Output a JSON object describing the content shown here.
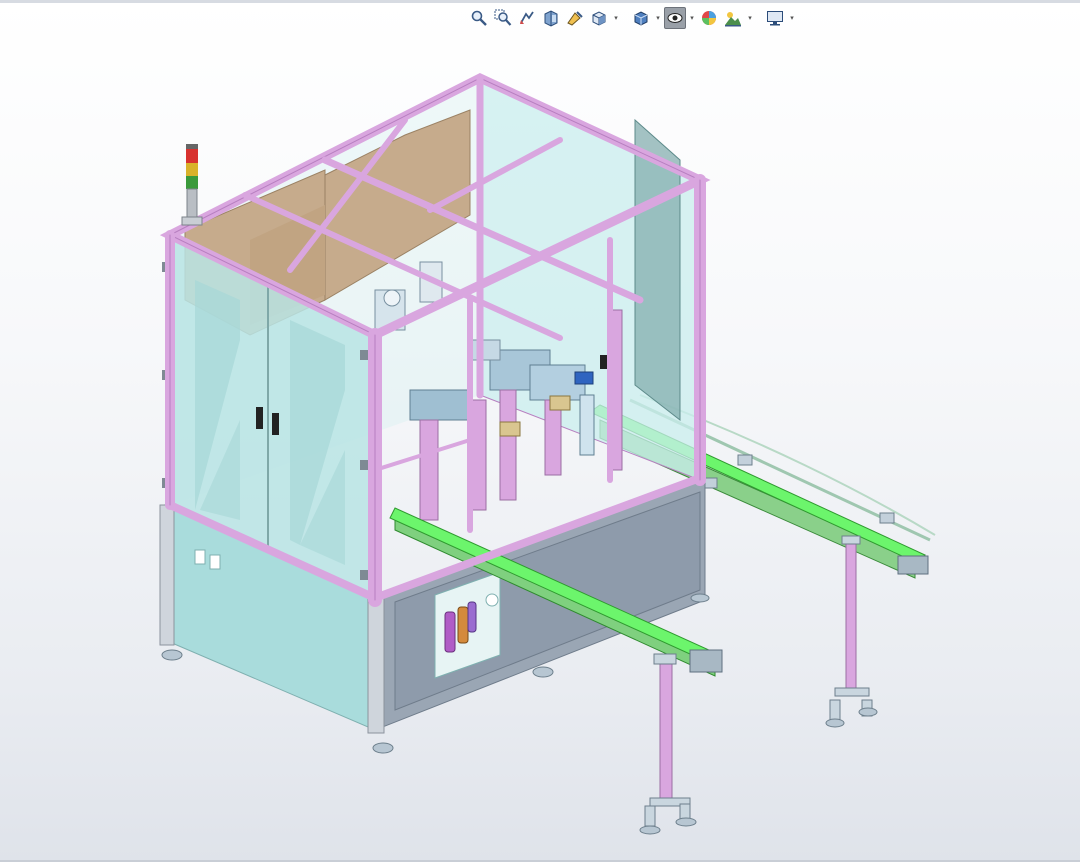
{
  "toolbar": {
    "buttons": [
      {
        "icon": "zoom-to-fit-icon"
      },
      {
        "icon": "zoom-to-area-icon"
      },
      {
        "icon": "previous-view-icon"
      },
      {
        "icon": "section-view-icon"
      },
      {
        "icon": "dynamic-annotation-icon"
      },
      {
        "icon": "view-orientation-icon",
        "dropdown": true
      },
      {
        "icon": "display-style-icon",
        "dropdown": true
      },
      {
        "icon": "hide-show-items-icon",
        "dropdown": true,
        "active": true
      },
      {
        "icon": "edit-appearance-icon"
      },
      {
        "icon": "apply-scene-icon",
        "dropdown": true
      },
      {
        "icon": "view-settings-icon",
        "dropdown": true
      }
    ]
  },
  "colors": {
    "frame": "#d9a6df",
    "frame_dark": "#b77fc0",
    "glass": "#c9eded",
    "panel": "#a9dcdc",
    "panel_dark": "#8fcaca",
    "belt": "#6cf56c",
    "belt_dark": "#3fd13f",
    "roof_panel": "#c6ab8c",
    "mechanism": "#9fbfd2",
    "background_top": "#ffffff",
    "background_bottom": "#dfe3ea"
  },
  "viewport": {
    "model_name": "",
    "components": [
      "frame",
      "doors",
      "glass-panels",
      "signal-tower",
      "conveyor-left",
      "conveyor-right",
      "legs",
      "internal-mechanism",
      "filter-regulator"
    ]
  }
}
